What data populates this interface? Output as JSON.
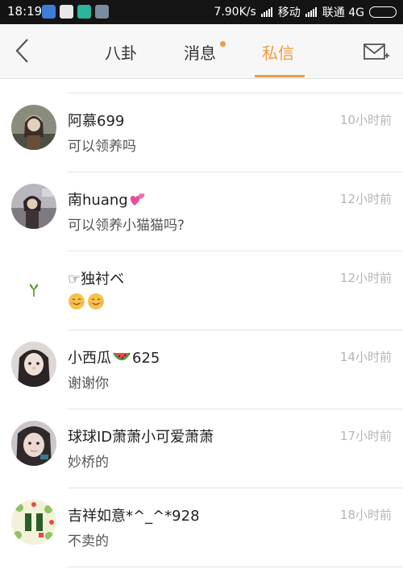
{
  "status_bar": {
    "time": "18:19",
    "speed": "7.90K/s",
    "carrier1": "移动",
    "carrier2": "联通 4G"
  },
  "header": {
    "tabs": [
      {
        "label": "八卦"
      },
      {
        "label": "消息"
      },
      {
        "label": "私信"
      }
    ],
    "active_tab": "私信",
    "accent_color": "#f39a3e"
  },
  "conversations": [
    {
      "name": "阿慕699",
      "time": "10小时前",
      "message": "可以领养吗"
    },
    {
      "name": "南huang",
      "time": "12小时前",
      "message": "可以领养小猫猫吗?"
    },
    {
      "name": "☞独衬ベ",
      "time": "12小时前",
      "message": ""
    },
    {
      "name": "小西瓜",
      "name_suffix": "625",
      "time": "14小时前",
      "message": "谢谢你"
    },
    {
      "name": "球球ID萧萧小可爱萧萧",
      "time": "17小时前",
      "message": "妙桥的"
    },
    {
      "name": "吉祥如意*^_^*928",
      "time": "18小时前",
      "message": "不卖的"
    }
  ]
}
